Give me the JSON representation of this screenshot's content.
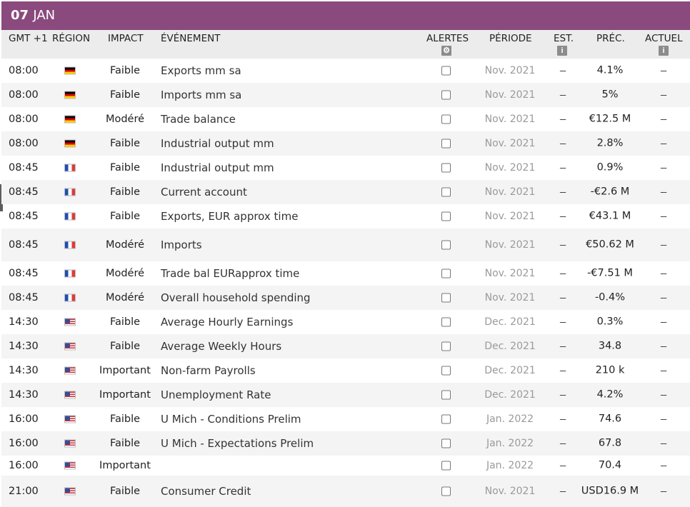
{
  "date": {
    "day": "07",
    "month": "JAN"
  },
  "columns": {
    "time": "GMT +1",
    "region": "RÉGION",
    "impact": "IMPACT",
    "event": "ÉVÉNEMENT",
    "alerts": "ALERTES",
    "alerts_icon": "gear-icon",
    "period": "PÉRIODE",
    "est": "EST.",
    "est_icon": "info-icon",
    "prec": "PRÉC.",
    "actual": "ACTUEL",
    "actual_icon": "info-icon"
  },
  "colors": {
    "header_bar": "#8a4a7d",
    "row_alt": "#f4f4f4",
    "column_header_bg": "#ececec"
  },
  "rows": [
    {
      "time": "08:00",
      "region": "de",
      "impact": "Faible",
      "event": "Exports mm sa",
      "period": "Nov. 2021",
      "est": "–",
      "prec": "4.1%",
      "actual": "–"
    },
    {
      "time": "08:00",
      "region": "de",
      "impact": "Faible",
      "event": "Imports mm sa",
      "period": "Nov. 2021",
      "est": "–",
      "prec": "5%",
      "actual": "–"
    },
    {
      "time": "08:00",
      "region": "de",
      "impact": "Modéré",
      "event": "Trade balance",
      "period": "Nov. 2021",
      "est": "–",
      "prec": "€12.5 M",
      "actual": "–"
    },
    {
      "time": "08:00",
      "region": "de",
      "impact": "Faible",
      "event": "Industrial output mm",
      "period": "Nov. 2021",
      "est": "–",
      "prec": "2.8%",
      "actual": "–"
    },
    {
      "time": "08:45",
      "region": "fr",
      "impact": "Faible",
      "event": "Industrial output mm",
      "period": "Nov. 2021",
      "est": "–",
      "prec": "0.9%",
      "actual": "–"
    },
    {
      "time": "08:45",
      "region": "fr",
      "impact": "Faible",
      "event": "Current account",
      "period": "Nov. 2021",
      "est": "–",
      "prec": "-€2.6 M",
      "actual": "–"
    },
    {
      "time": "08:45",
      "region": "fr",
      "impact": "Faible",
      "event": "Exports, EUR approx time",
      "period": "Nov. 2021",
      "est": "–",
      "prec": "€43.1 M",
      "actual": "–"
    },
    {
      "time": "08:45",
      "region": "fr",
      "impact": "Modéré",
      "event": "Imports",
      "period": "Nov. 2021",
      "est": "–",
      "prec": "€50.62 M",
      "actual": "–"
    },
    {
      "time": "08:45",
      "region": "fr",
      "impact": "Modéré",
      "event": "Trade bal EURapprox time",
      "period": "Nov. 2021",
      "est": "–",
      "prec": "-€7.51 M",
      "actual": "–"
    },
    {
      "time": "08:45",
      "region": "fr",
      "impact": "Modéré",
      "event": "Overall household spending",
      "period": "Nov. 2021",
      "est": "–",
      "prec": "-0.4%",
      "actual": "–"
    },
    {
      "time": "14:30",
      "region": "us",
      "impact": "Faible",
      "event": "Average Hourly Earnings",
      "period": "Dec. 2021",
      "est": "–",
      "prec": "0.3%",
      "actual": "–"
    },
    {
      "time": "14:30",
      "region": "us",
      "impact": "Faible",
      "event": "Average Weekly Hours",
      "period": "Dec. 2021",
      "est": "–",
      "prec": "34.8",
      "actual": "–"
    },
    {
      "time": "14:30",
      "region": "us",
      "impact": "Important",
      "event": "Non-farm Payrolls",
      "period": "Dec. 2021",
      "est": "–",
      "prec": "210 k",
      "actual": "–"
    },
    {
      "time": "14:30",
      "region": "us",
      "impact": "Important",
      "event": "Unemployment Rate",
      "period": "Dec. 2021",
      "est": "–",
      "prec": "4.2%",
      "actual": "–"
    },
    {
      "time": "16:00",
      "region": "us",
      "impact": "Faible",
      "event": "U Mich - Conditions Prelim",
      "period": "Jan. 2022",
      "est": "–",
      "prec": "74.6",
      "actual": "–"
    },
    {
      "time": "16:00",
      "region": "us",
      "impact": "Faible",
      "event": "U Mich - Expectations Prelim",
      "period": "Jan. 2022",
      "est": "–",
      "prec": "67.8",
      "actual": "–"
    },
    {
      "time": "16:00",
      "region": "us",
      "impact": "Important",
      "event": "",
      "period": "Jan. 2022",
      "est": "–",
      "prec": "70.4",
      "actual": "–"
    },
    {
      "time": "21:00",
      "region": "us",
      "impact": "Faible",
      "event": "Consumer Credit",
      "period": "Nov. 2021",
      "est": "–",
      "prec": "USD16.9 M",
      "actual": "–"
    }
  ]
}
